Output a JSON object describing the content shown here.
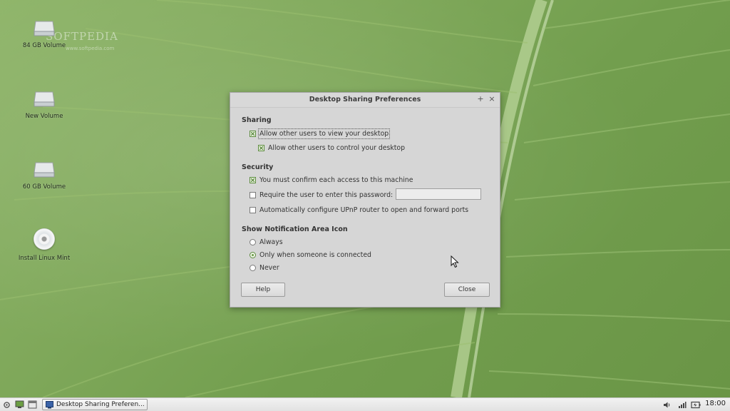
{
  "desktop": {
    "watermark": "SOFTPEDIA",
    "watermark_sub": "www.softpedia.com",
    "icons": [
      {
        "label": "84 GB Volume",
        "icon": "drive-icon"
      },
      {
        "label": "New Volume",
        "icon": "drive-icon"
      },
      {
        "label": "60 GB Volume",
        "icon": "drive-icon"
      },
      {
        "label": "Install Linux Mint",
        "icon": "cd-icon"
      }
    ]
  },
  "dialog": {
    "title": "Desktop Sharing Preferences",
    "titlebar_buttons": {
      "maximize": "+",
      "close": "×"
    },
    "sharing": {
      "title": "Sharing",
      "allow_view": {
        "label": "Allow other users to view your desktop",
        "checked": true
      },
      "allow_control": {
        "label": "Allow other users to control your desktop",
        "checked": true
      }
    },
    "security": {
      "title": "Security",
      "confirm_access": {
        "label": "You must confirm each access to this machine",
        "checked": true
      },
      "require_password": {
        "label": "Require the user to enter this password:",
        "checked": false
      },
      "password_value": "",
      "upnp": {
        "label": "Automatically configure UPnP router to open and forward ports",
        "checked": false
      }
    },
    "notification": {
      "title": "Show Notification Area Icon",
      "options": [
        {
          "label": "Always",
          "selected": false
        },
        {
          "label": "Only when someone is connected",
          "selected": true
        },
        {
          "label": "Never",
          "selected": false
        }
      ]
    },
    "buttons": {
      "help": "Help",
      "close": "Close"
    }
  },
  "taskbar": {
    "task_label": "Desktop Sharing Preferen...",
    "clock": "18:00"
  },
  "colors": {
    "accent": "#5d8b3f",
    "wallpaper": "#7fa85a"
  }
}
